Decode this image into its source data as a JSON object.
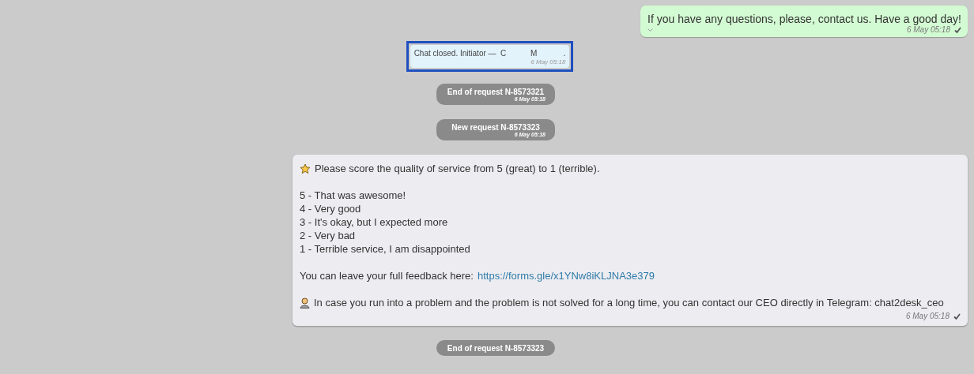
{
  "messages": [
    {
      "kind": "outgoing",
      "text": "If you have any questions, please, contact us. Have a good day!",
      "time": "6 May 05:18",
      "delivered": true
    },
    {
      "kind": "note",
      "text": "Chat closed. Initiator —  C           M            .",
      "time": "6 May 05:18",
      "selected": true
    },
    {
      "kind": "event",
      "text": "End of request N-8573321",
      "time": "6 May 05:18"
    },
    {
      "kind": "event",
      "text": "New request N-8573323",
      "time": "6 May 05:18"
    },
    {
      "kind": "rich",
      "intro": "Please score the quality of service from 5 (great) to 1 (terrible).",
      "options": [
        "5 - That was awesome!",
        "4 - Very good",
        "3 - It's okay, but I expected more",
        "2 - Very bad",
        "1 - Terrible service, I am disappointed"
      ],
      "feedback_label": "You can leave your full feedback here:",
      "feedback_link": "https://forms.gle/x1YNw8iKLJNA3e379",
      "contact": "In case you run into a problem and the problem is not solved for a long time, you can contact our CEO directly in Telegram: chat2desk_ceo",
      "time": "6 May 05:18",
      "delivered": true
    },
    {
      "kind": "event",
      "text": "End of request N-8573323"
    }
  ]
}
